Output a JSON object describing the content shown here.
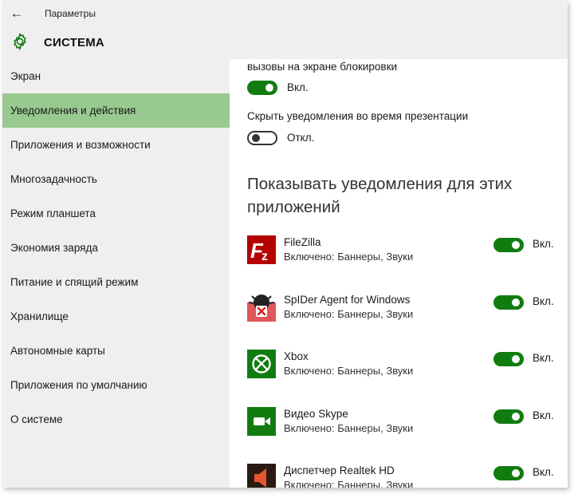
{
  "window": {
    "title": "Параметры"
  },
  "header": {
    "title": "СИСТЕМА"
  },
  "sidebar": {
    "items": [
      {
        "label": "Экран",
        "active": false
      },
      {
        "label": "Уведомления и действия",
        "active": true
      },
      {
        "label": "Приложения и возможности",
        "active": false
      },
      {
        "label": "Многозадачность",
        "active": false
      },
      {
        "label": "Режим планшета",
        "active": false
      },
      {
        "label": "Экономия заряда",
        "active": false
      },
      {
        "label": "Питание и спящий режим",
        "active": false
      },
      {
        "label": "Хранилище",
        "active": false
      },
      {
        "label": "Автономные карты",
        "active": false
      },
      {
        "label": "Приложения по умолчанию",
        "active": false
      },
      {
        "label": "О системе",
        "active": false
      }
    ]
  },
  "content": {
    "lockscreen_calls": {
      "label": "вызовы на экране блокировки",
      "state": "Вкл.",
      "on": true
    },
    "hide_during_presentation": {
      "label": "Скрыть уведомления во время презентации",
      "state": "Откл.",
      "on": false
    },
    "apps_heading": "Показывать уведомления для этих приложений",
    "apps": [
      {
        "name": "FileZilla",
        "status": "Включено: Баннеры, Звуки",
        "state": "Вкл.",
        "icon": "filezilla-icon"
      },
      {
        "name": "SpIDer Agent for Windows",
        "status": "Включено: Баннеры, Звуки",
        "state": "Вкл.",
        "icon": "spider-agent-icon"
      },
      {
        "name": "Xbox",
        "status": "Включено: Баннеры, Звуки",
        "state": "Вкл.",
        "icon": "xbox-icon"
      },
      {
        "name": "Видео Skype",
        "status": "Включено: Баннеры, Звуки",
        "state": "Вкл.",
        "icon": "skype-video-icon"
      },
      {
        "name": "Диспетчер Realtek HD",
        "status": "Включено: Баннеры, Звуки",
        "state": "Вкл.",
        "icon": "realtek-speaker-icon"
      }
    ]
  },
  "colors": {
    "accent": "#107c10",
    "active_nav": "#98c98f",
    "chrome": "#efefef"
  }
}
